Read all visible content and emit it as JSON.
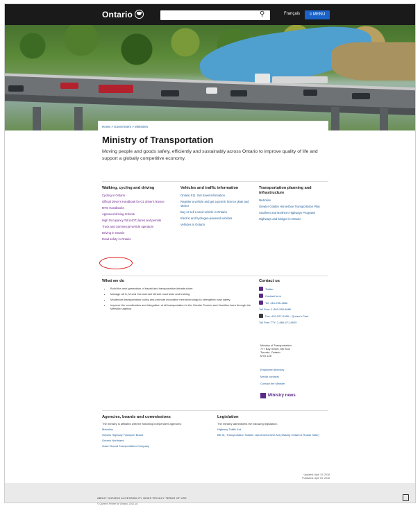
{
  "header": {
    "logo_text": "Ontario",
    "logo_icon": "trillium-icon",
    "search_placeholder": "",
    "search_icon": "search-icon",
    "language_label": "Français",
    "menu_label": "≡ MENU"
  },
  "breadcrumb": "Home > Government > Ministries",
  "page_title": "Ministry of Transportation",
  "subtitle": "Moving people and goods safely, efficiently and sustainably across Ontario to improve quality of life and support a globally competitive economy.",
  "columns": [
    {
      "heading": "Walking, cycling and driving",
      "links": [
        "Cycling in Ontario",
        "Official Driver's Handbook for G1 driver's licence",
        "MTO Handbooks",
        "Approved driving schools",
        "High Occupancy Toll (HOT) lanes and permits",
        "Truck and commercial vehicle operators",
        "Driving in Ontario",
        "Road safety in Ontario"
      ]
    },
    {
      "heading": "Vehicles and traffic information",
      "links": [
        "Ontario 511: Get travel information",
        "Register a vehicle and get a permit, licence plate and sticker",
        "Buy or sell a used vehicle in Ontario",
        "Electric and hydrogen-powered vehicles",
        "Vehicles in Ontario"
      ]
    },
    {
      "heading": "Transportation planning and infrastructure",
      "links": [
        "Metrolinx",
        "Greater Golden Horseshoe Transportation Plan",
        "Southern and Northern Highways Programs",
        "Highways and bridges in Ontario"
      ]
    }
  ],
  "what_we_do": {
    "heading": "What we do",
    "items": [
      "Build the next generation of transit and transportation infrastructure",
      "Manage all G, M and Commercial Vehicle road tests and training",
      "Modernize transportation policy and promote innovative new technology to strengthen road safety",
      "Improve the coordination and integration of all transportation in the Greater Toronto and Hamilton Area through the Metrolinx agency"
    ]
  },
  "contact": {
    "heading": "Contact us",
    "items": [
      {
        "icon": "twitter-icon",
        "label": "Twitter"
      },
      {
        "icon": "email-icon",
        "label": "Contact form"
      },
      {
        "icon": "phone-icon",
        "label": "Tel: 416-235-4686"
      },
      {
        "icon": "",
        "label": "Toll Free: 1-800-268-4686"
      },
      {
        "icon": "hours-icon",
        "label": "Fax: 416-327-9188 – Queen's Park"
      },
      {
        "icon": "",
        "label": "Toll Free TTY: 1-866-471-8929"
      }
    ],
    "address": [
      "Ministry of Transportation",
      "777 Bay Street, 5th floor",
      "Toronto, Ontario",
      "M7A 1Z8"
    ],
    "links": [
      "Employee directory",
      "Media contacts",
      "Contact the Minister"
    ],
    "news_label": "Ministry news"
  },
  "agencies": {
    "heading": "Agencies, boards and commissions",
    "intro": "The ministry is affiliated with the following independent agencies:",
    "links": [
      "Metrolinx",
      "Ontario Highway Transport Board",
      "Ontario Northland",
      "Owen Sound Transportation Company"
    ]
  },
  "legislation": {
    "heading": "Legislation",
    "intro": "The ministry administers the following legislation:",
    "links": [
      "Highway Traffic Act",
      "Bill 31, Transportation Statute Law Amendment Act (Making Ontario's Roads Safer)"
    ]
  },
  "updated": [
    "Updated: April 13, 2018",
    "Published: April 03, 2018"
  ],
  "footer": {
    "links": "ABOUT ONTARIO   ACCESSIBILITY   NEWS   PRIVACY   TERMS OF USE",
    "copyright": "© Queen's Printer for Ontario, 2012-18"
  },
  "colors": {
    "topbar": "#1a1a1a",
    "menu_button": "#1a62c7",
    "visited_link": "#6a1f8a",
    "link": "#1a5a96",
    "highlight_oval": "#e02020"
  }
}
